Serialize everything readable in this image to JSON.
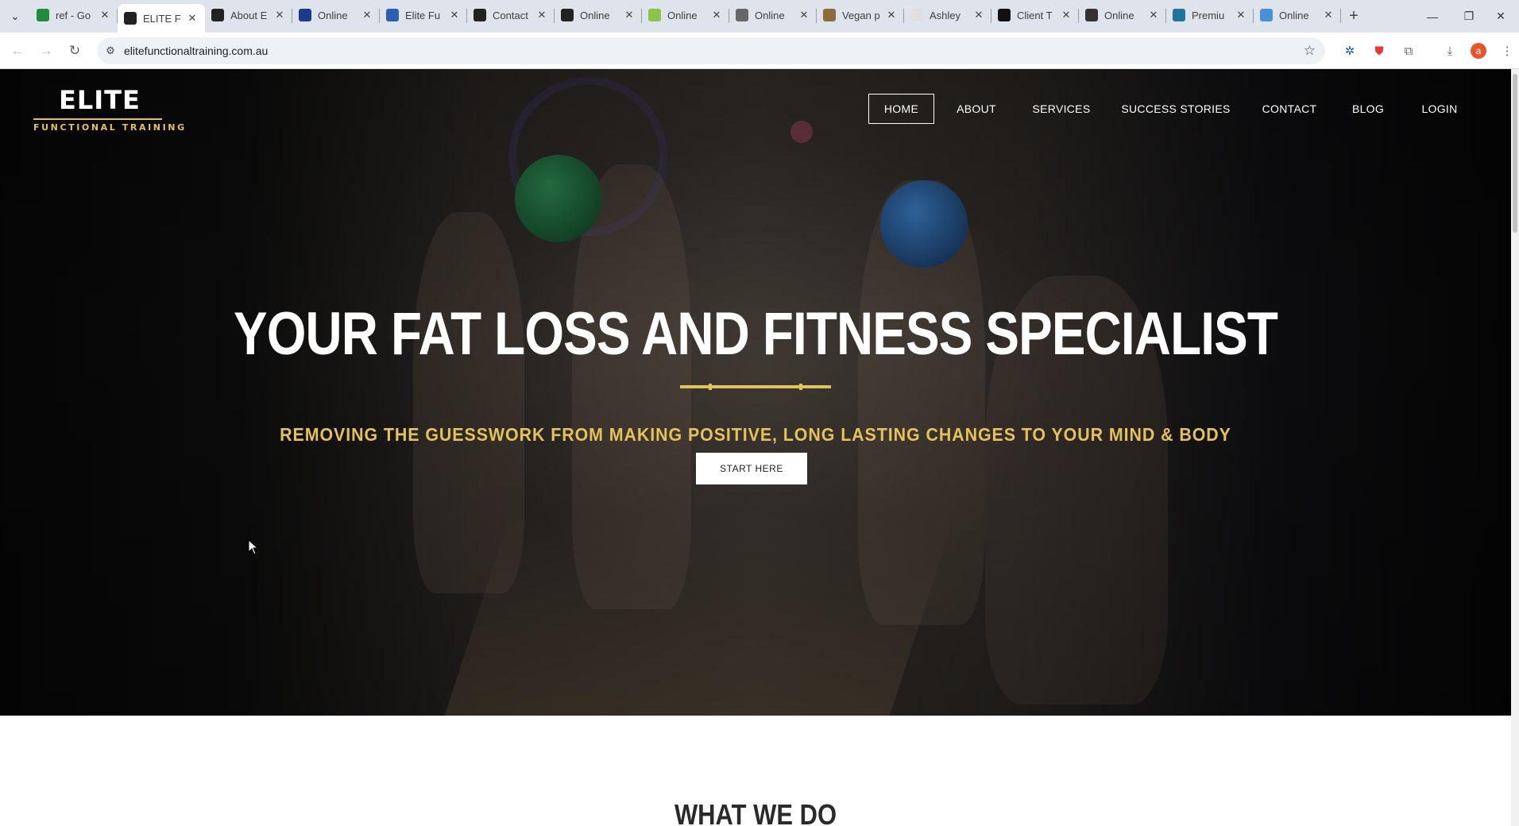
{
  "browser": {
    "tabs": [
      {
        "label": "ref - Go",
        "icon": "sheets-icon",
        "color": "#1e8e3e",
        "active": false
      },
      {
        "label": "ELITE F",
        "icon": "elite-favicon",
        "color": "#222222",
        "active": true
      },
      {
        "label": "About E",
        "icon": "elite-favicon",
        "color": "#222222",
        "active": false
      },
      {
        "label": "Online",
        "icon": "circle-favicon",
        "color": "#1a3a8a",
        "active": false
      },
      {
        "label": "Elite Fu",
        "icon": "swirl-favicon",
        "color": "#2b5fb3",
        "active": false
      },
      {
        "label": "Contact",
        "icon": "elite-favicon",
        "color": "#222222",
        "active": false
      },
      {
        "label": "Online",
        "icon": "elite-favicon",
        "color": "#222222",
        "active": false
      },
      {
        "label": "Online",
        "icon": "lime-circle-favicon",
        "color": "#8bc34a",
        "active": false
      },
      {
        "label": "Online",
        "icon": "script-favicon",
        "color": "#666666",
        "active": false
      },
      {
        "label": "Vegan p",
        "icon": "figure-favicon",
        "color": "#8a6d3b",
        "active": false
      },
      {
        "label": "Ashley",
        "icon": "blank-favicon",
        "color": "#e0e0e0",
        "active": false
      },
      {
        "label": "Client T",
        "icon": "chart-favicon",
        "color": "#111111",
        "active": false
      },
      {
        "label": "Online",
        "icon": "box-favicon",
        "color": "#333333",
        "active": false
      },
      {
        "label": "Premiu",
        "icon": "wp-favicon",
        "color": "#21759b",
        "active": false
      },
      {
        "label": "Online",
        "icon": "doc-favicon",
        "color": "#4a90d9",
        "active": false
      }
    ],
    "url": "elitefunctionaltraining.com.au",
    "profile_initial": "a"
  },
  "site": {
    "logo": {
      "main": "ELITE",
      "sub": "FUNCTIONAL TRAINING"
    },
    "nav": [
      {
        "label": "HOME",
        "active": true
      },
      {
        "label": "ABOUT",
        "active": false
      },
      {
        "label": "SERVICES",
        "active": false
      },
      {
        "label": "SUCCESS STORIES",
        "active": false
      },
      {
        "label": "CONTACT",
        "active": false
      },
      {
        "label": "BLOG",
        "active": false
      },
      {
        "label": "LOGIN",
        "active": false
      }
    ],
    "hero": {
      "title": "YOUR FAT LOSS AND FITNESS SPECIALIST",
      "subtitle": "REMOVING THE GUESSWORK FROM MAKING POSITIVE, LONG LASTING CHANGES TO YOUR MIND & BODY",
      "cta_label": "START HERE"
    },
    "next_section_heading": "WHAT WE DO"
  },
  "colors": {
    "accent_gold": "#e5c15a",
    "hero_bg": "#1a1817",
    "tabbar_bg": "#dfe3eb"
  }
}
